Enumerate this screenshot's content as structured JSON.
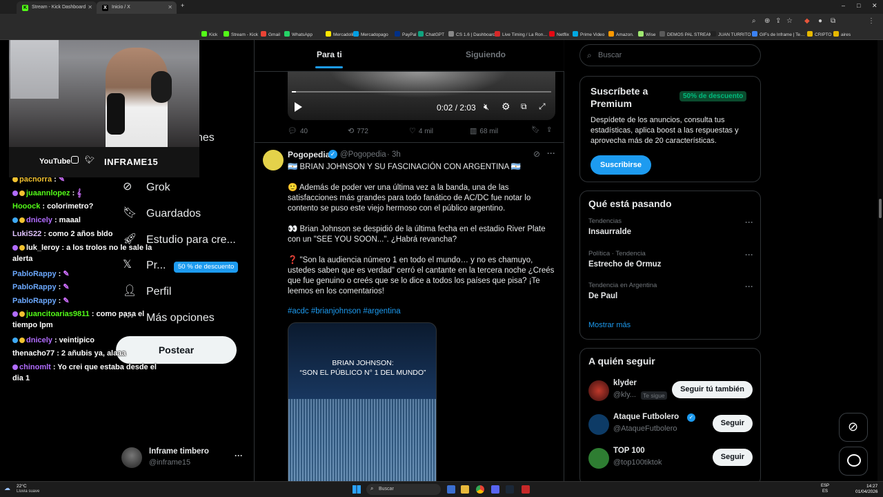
{
  "browser": {
    "tabs": [
      {
        "title": "Stream - Kick Dashboard",
        "icon": "kick-icon"
      },
      {
        "title": "Inicio / X",
        "icon": "x-icon"
      }
    ],
    "new_tab": "+",
    "window_controls": [
      "–",
      "□",
      "✕"
    ],
    "bookmarks": [
      "Kick",
      "Stream - Kick",
      "Gmail",
      "WhatsApp",
      "Mercadolibre",
      "Mercadopago",
      "PayPal",
      "ChatGPT",
      "CS 1.6 | Dashboard",
      "Live Timing / La Ron…",
      "Netflix",
      "Prime Video",
      "Amazon.",
      "Wise",
      "DEMOS PAL STREAM",
      "JUAN TURRITO",
      "GIFs de Inframe | Te…",
      "CRIPTO",
      "aires"
    ],
    "colors": {
      "accent": "#1d9bf0",
      "kick": "#53fc18"
    }
  },
  "webcam": {
    "youtube": "YouTube",
    "handle": "INFRAME15"
  },
  "nav": {
    "partial_item": "nes",
    "items": [
      {
        "label": "Grok",
        "icon": "grok-icon"
      },
      {
        "label": "Guardados",
        "icon": "bookmark-icon"
      },
      {
        "label": "Estudio para cre...",
        "icon": "rocket-icon"
      },
      {
        "label": "Pr...",
        "icon": "x-logo-icon"
      },
      {
        "label": "Perfil",
        "icon": "person-icon"
      },
      {
        "label": "Más opciones",
        "icon": "more-circle-icon"
      }
    ],
    "premium_pill": "50 % de descuento",
    "post_button": "Postear",
    "account_name": "Inframe timbero",
    "account_handle": "@inframe15",
    "account_more": "···"
  },
  "chat": [
    {
      "user": "pachorra",
      "text": " : ",
      "emote": "✎",
      "color": "#f2c230"
    },
    {
      "user": "juaannlopez",
      "text": " : ",
      "emote": "𝄞",
      "color": "#53fc18"
    },
    {
      "user": "Hooock",
      "text": " : colorimetro?",
      "color": "#53fc18"
    },
    {
      "user": "dnicely",
      "text": " : maaal",
      "color": "#b16cff"
    },
    {
      "user": "LukiS22",
      "text": " : como 2 años bldo",
      "color": "#e0c3ff"
    },
    {
      "user": "luk_leroy",
      "text": " : a los trolos no le sale la alerta",
      "color": "#ffffff"
    },
    {
      "user": "PabloRappy",
      "text": " : ",
      "emote": "✎",
      "color": "#6ca9ff"
    },
    {
      "user": "PabloRappy",
      "text": " : ",
      "emote": "✎",
      "color": "#6ca9ff"
    },
    {
      "user": "PabloRappy",
      "text": " : ",
      "emote": "✎",
      "color": "#6ca9ff"
    },
    {
      "user": "juancitoarias9811",
      "text": " : como pasa el tiempo lpm",
      "color": "#53fc18"
    },
    {
      "user": "dnicely",
      "text": " : veintipico",
      "color": "#b16cff"
    },
    {
      "user": "thenacho77",
      "text": " : 2 añubis ya, alaaa",
      "color": "#ffffff"
    },
    {
      "user": "chinomlt",
      "text": " : Yo crei que estaba desde el dia 1",
      "color": "#b16cff"
    }
  ],
  "feed": {
    "tabs": [
      "Para ti",
      "Siguiendo"
    ],
    "video": {
      "time": "0:02 / 2:03",
      "progress": 0.016
    },
    "prev_actions": {
      "replies": "40",
      "reposts": "772",
      "likes": "4 mil",
      "views": "68 mil"
    },
    "tweet": {
      "name": "Pogopedia",
      "handle": "@Pogopedia",
      "time": "· 3h",
      "headline": "🇦🇷  BRIAN JOHNSON Y SU FASCINACIÓN CON ARGENTINA 🇦🇷",
      "p1": "🙂 Además de poder ver una última vez a la banda, una de las satisfacciones más grandes para todo fanático de AC/DC fue notar lo contento se puso este viejo hermoso con el público argentino.",
      "p2": "👀  Brian Johnson se despidió de la última fecha en el estadio River Plate con un \"SEE YOU SOON...\". ¿Habrá revancha?",
      "p3": "❓ \"Son la audiencia número 1 en todo el mundo… y no es chamuyo, ustedes saben que es verdad\" cerró el cantante en la tercera noche ¿Creés que fue genuino o creés que se lo dice a todos los países que pisa? ¡Te leemos en los comentarios!",
      "hashtags": "#acdc #brianjohnson #argentina",
      "media_caption_1": "BRIAN JOHNSON:",
      "media_caption_2": "“SON EL PÚBLICO N° 1 DEL MUNDO”"
    }
  },
  "right": {
    "search_placeholder": "Buscar",
    "premium": {
      "title": "Suscríbete a Premium",
      "badge": "50% de descuento",
      "desc": "Despídete de los anuncios, consulta tus estadísticas, aplica boost a las respuestas y aprovecha más de 20 características.",
      "button": "Suscribirse"
    },
    "trends": {
      "title": "Qué está pasando",
      "items": [
        {
          "meta": "Tendencias",
          "name": "Insaurralde"
        },
        {
          "meta": "Política · Tendencia",
          "name": "Estrecho de Ormuz"
        },
        {
          "meta": "Tendencia en Argentina",
          "name": "De Paul"
        }
      ],
      "more": "Mostrar más"
    },
    "follow": {
      "title": "A quién seguir",
      "items": [
        {
          "name": "klyder",
          "handle": "@kly...",
          "tag": "Te sigue",
          "button": "Seguir tú también"
        },
        {
          "name": "Ataque Futbolero",
          "handle": "@AtaqueFutbolero",
          "button": "Seguir"
        },
        {
          "name": "TOP 100",
          "handle": "@top100tiktok",
          "button": "Seguir"
        }
      ]
    }
  },
  "taskbar": {
    "weather_temp": "22°C",
    "weather_desc": "Lluvia suave",
    "search": "Buscar",
    "lang_1": "ESP",
    "lang_2": "ES",
    "time": "14:27",
    "date": "01/04/2026"
  }
}
